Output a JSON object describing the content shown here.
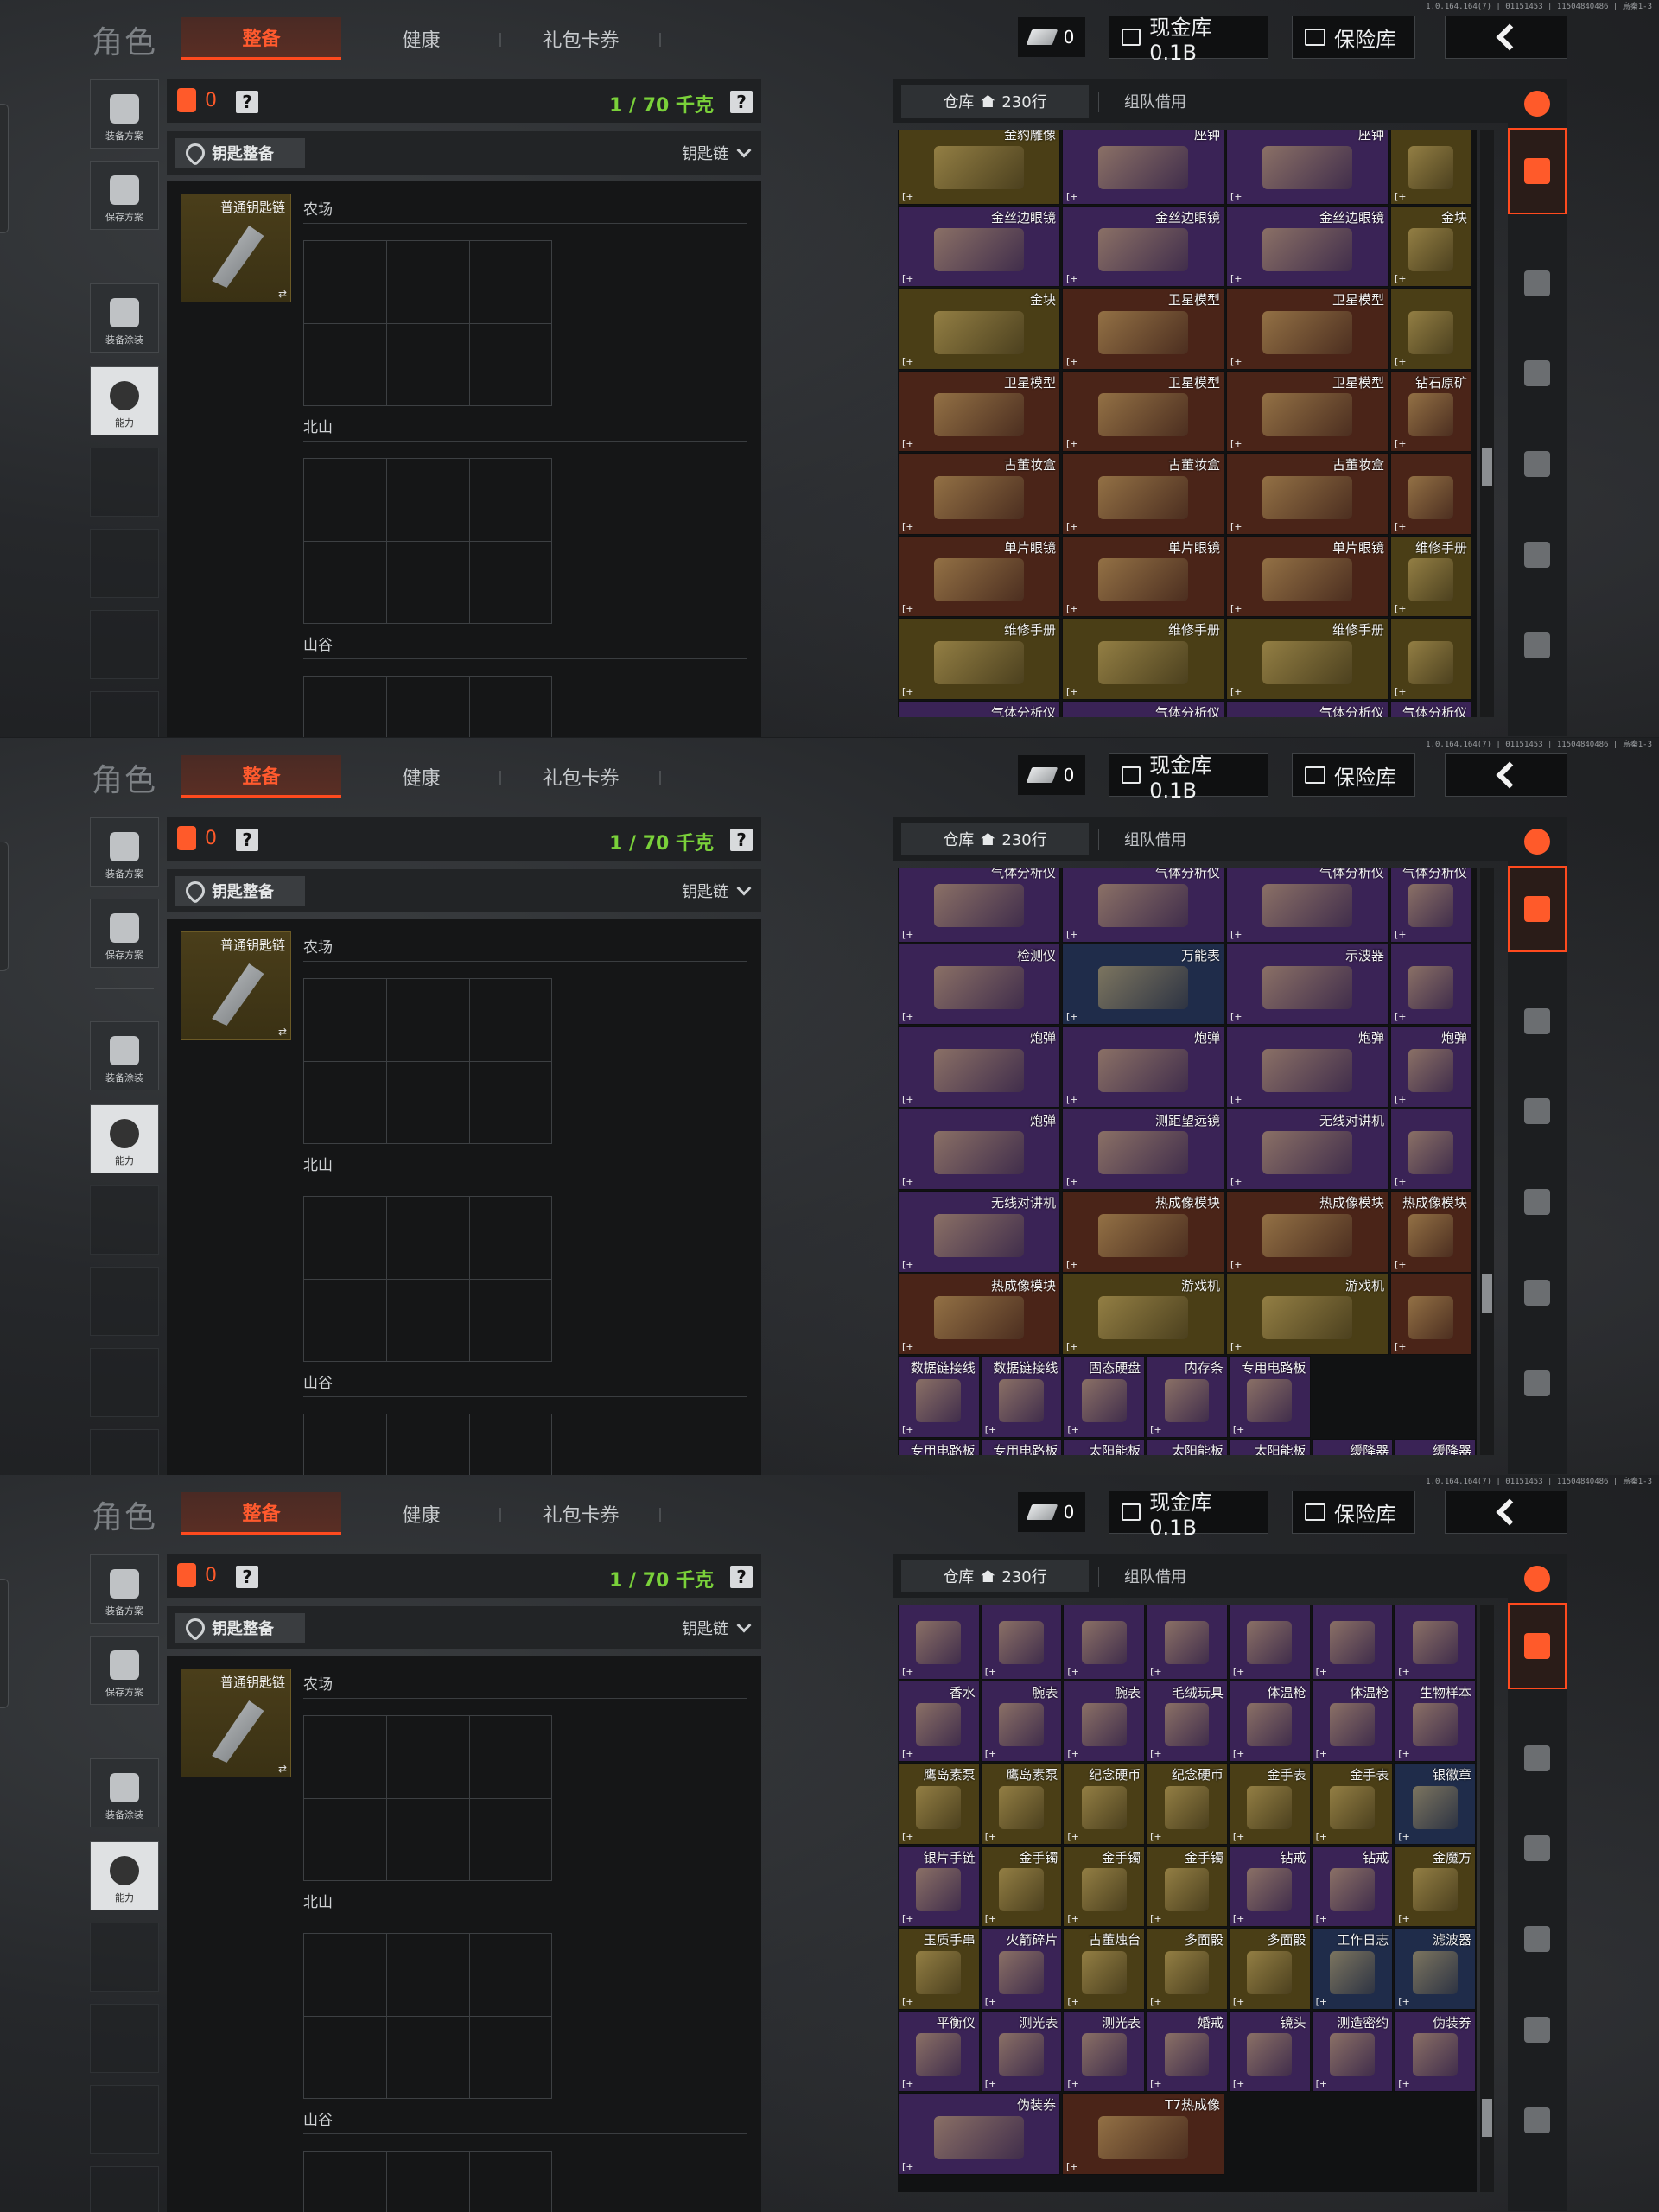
{
  "screens": [
    {
      "version": "1.0.164.164(7) | 01151453 | 11504840486 | 烏秦1-3",
      "title": "角色",
      "tabs": [
        "整备",
        "健康",
        "礼包卡券"
      ],
      "coins": "0",
      "cash_btn": "现金库 0.1B",
      "safe_btn": "保险库",
      "side": [
        "装备方案",
        "保存方案",
        "装备涂装",
        "能力"
      ],
      "bp_count": "0",
      "weight": "1 / 70 千克",
      "key_prep": "钥匙整备",
      "keychain": "钥匙链",
      "key_item": "普通钥匙链",
      "areas": [
        "农场",
        "北山",
        "山谷"
      ],
      "warehouse_tab": "仓库",
      "warehouse_rows": "230行",
      "team_tab": "组队借用",
      "rows": [
        [
          [
            "金豹雕像",
            "#4a3e16"
          ],
          [
            "座钟",
            "#3a2356"
          ],
          [
            "座钟",
            "#3a2356"
          ],
          [
            "",
            "#4a3e16"
          ]
        ],
        [
          [
            "金丝边眼镜",
            "#3a2356"
          ],
          [
            "金丝边眼镜",
            "#3a2356"
          ],
          [
            "金丝边眼镜",
            "#3a2356"
          ],
          [
            "金块",
            "#4a3e16"
          ]
        ],
        [
          [
            "金块",
            "#4a3e16"
          ],
          [
            "卫星模型",
            "#4a2418"
          ],
          [
            "卫星模型",
            "#4a2418"
          ],
          [
            "",
            "#4a3e16"
          ]
        ],
        [
          [
            "卫星模型",
            "#4a2418"
          ],
          [
            "卫星模型",
            "#4a2418"
          ],
          [
            "卫星模型",
            "#4a2418"
          ],
          [
            "钻石原矿",
            "#4a2418"
          ]
        ],
        [
          [
            "古董妆盒",
            "#4a2418"
          ],
          [
            "古董妆盒",
            "#4a2418"
          ],
          [
            "古董妆盒",
            "#4a2418"
          ],
          [
            "",
            "#4a2418"
          ]
        ],
        [
          [
            "单片眼镜",
            "#4a2418"
          ],
          [
            "单片眼镜",
            "#4a2418"
          ],
          [
            "单片眼镜",
            "#4a2418"
          ],
          [
            "维修手册",
            "#4a3e16"
          ]
        ],
        [
          [
            "维修手册",
            "#4a3e16"
          ],
          [
            "维修手册",
            "#4a3e16"
          ],
          [
            "维修手册",
            "#4a3e16"
          ],
          [
            "",
            "#4a3e16"
          ]
        ],
        [
          [
            "气体分析仪",
            "#3a2356"
          ],
          [
            "气体分析仪",
            "#3a2356"
          ],
          [
            "气体分析仪",
            "#3a2356"
          ],
          [
            "气体分析仪",
            "#3a2356"
          ]
        ]
      ],
      "thumb_pct": 58
    },
    {
      "version": "1.0.164.164(7) | 01151453 | 11504840486 | 烏秦1-3",
      "title": "角色",
      "tabs": [
        "整备",
        "健康",
        "礼包卡券"
      ],
      "coins": "0",
      "cash_btn": "现金库 0.1B",
      "safe_btn": "保险库",
      "side": [
        "装备方案",
        "保存方案",
        "装备涂装",
        "能力"
      ],
      "bp_count": "0",
      "weight": "1 / 70 千克",
      "key_prep": "钥匙整备",
      "keychain": "钥匙链",
      "key_item": "普通钥匙链",
      "areas": [
        "农场",
        "北山",
        "山谷"
      ],
      "warehouse_tab": "仓库",
      "warehouse_rows": "230行",
      "team_tab": "组队借用",
      "rows": [
        [
          [
            "气体分析仪",
            "#3a2356"
          ],
          [
            "气体分析仪",
            "#3a2356"
          ],
          [
            "气体分析仪",
            "#3a2356"
          ],
          [
            "气体分析仪",
            "#3a2356"
          ]
        ],
        [
          [
            "检测仪",
            "#3a2356"
          ],
          [
            "万能表",
            "#1f2c4a"
          ],
          [
            "示波器",
            "#3a2356"
          ],
          [
            "",
            "#3a2356"
          ]
        ],
        [
          [
            "炮弹",
            "#3a2356"
          ],
          [
            "炮弹",
            "#3a2356"
          ],
          [
            "炮弹",
            "#3a2356"
          ],
          [
            "炮弹",
            "#3a2356"
          ]
        ],
        [
          [
            "炮弹",
            "#3a2356"
          ],
          [
            "测距望远镜",
            "#3a2356"
          ],
          [
            "无线对讲机",
            "#3a2356"
          ],
          [
            "",
            "#3a2356"
          ]
        ],
        [
          [
            "无线对讲机",
            "#3a2356"
          ],
          [
            "热成像模块",
            "#4a2418"
          ],
          [
            "热成像模块",
            "#4a2418"
          ],
          [
            "热成像模块",
            "#4a2418"
          ]
        ],
        [
          [
            "热成像模块",
            "#4a2418"
          ],
          [
            "游戏机",
            "#4a3e16"
          ],
          [
            "游戏机",
            "#4a3e16"
          ],
          [
            "",
            "#4a2418"
          ]
        ],
        [
          [
            "数据链接线",
            "#3a2356"
          ],
          [
            "数据链接线",
            "#3a2356"
          ],
          [
            "固态硬盘",
            "#3a2356"
          ],
          [
            "内存条",
            "#3a2356"
          ],
          [
            "专用电路板",
            "#3a2356"
          ]
        ],
        [
          [
            "专用电路板",
            "#3a2356"
          ],
          [
            "专用电路板",
            "#3a2356"
          ],
          [
            "太阳能板",
            "#3a2356"
          ],
          [
            "太阳能板",
            "#3a2356"
          ],
          [
            "太阳能板",
            "#3a2356"
          ],
          [
            "缓降器",
            "#3a2356"
          ],
          [
            "缓降器",
            "#3a2356"
          ]
        ]
      ],
      "thumb_pct": 74
    },
    {
      "version": "1.0.164.164(7) | 01151453 | 11504840486 | 烏秦1-3",
      "title": "角色",
      "tabs": [
        "整备",
        "健康",
        "礼包卡券"
      ],
      "coins": "0",
      "cash_btn": "现金库 0.1B",
      "safe_btn": "保险库",
      "side": [
        "装备方案",
        "保存方案",
        "装备涂装",
        "能力"
      ],
      "bp_count": "0",
      "weight": "1 / 70 千克",
      "key_prep": "钥匙整备",
      "keychain": "钥匙链",
      "key_item": "普通钥匙链",
      "areas": [
        "农场",
        "北山",
        "山谷"
      ],
      "warehouse_tab": "仓库",
      "warehouse_rows": "230行",
      "team_tab": "组队借用",
      "rows": [
        [
          [
            "",
            "#3a2356"
          ],
          [
            "",
            "#3a2356"
          ],
          [
            "",
            "#3a2356"
          ],
          [
            "",
            "#3a2356"
          ],
          [
            "",
            "#3a2356"
          ],
          [
            "",
            "#3a2356"
          ],
          [
            "",
            "#3a2356"
          ]
        ],
        [
          [
            "香水",
            "#3a2356"
          ],
          [
            "腕表",
            "#3a2356"
          ],
          [
            "腕表",
            "#3a2356"
          ],
          [
            "毛绒玩具",
            "#3a2356"
          ],
          [
            "体温枪",
            "#3a2356"
          ],
          [
            "体温枪",
            "#3a2356"
          ],
          [
            "生物样本",
            "#3a2356"
          ]
        ],
        [
          [
            "鹰岛素泵",
            "#4a3e16"
          ],
          [
            "鹰岛素泵",
            "#4a3e16"
          ],
          [
            "纪念硬币",
            "#4a3e16"
          ],
          [
            "纪念硬币",
            "#4a3e16"
          ],
          [
            "金手表",
            "#4a3e16"
          ],
          [
            "金手表",
            "#4a3e16"
          ],
          [
            "银徽章",
            "#1f2c4a"
          ]
        ],
        [
          [
            "银片手链",
            "#3a2356"
          ],
          [
            "金手镯",
            "#4a3e16"
          ],
          [
            "金手镯",
            "#4a3e16"
          ],
          [
            "金手镯",
            "#4a3e16"
          ],
          [
            "钻戒",
            "#3a2356"
          ],
          [
            "钻戒",
            "#3a2356"
          ],
          [
            "金魔方",
            "#4a3e16"
          ]
        ],
        [
          [
            "玉质手串",
            "#4a3e16"
          ],
          [
            "火箭碎片",
            "#3a2356"
          ],
          [
            "古董烛台",
            "#4a3e16"
          ],
          [
            "多面骰",
            "#4a3e16"
          ],
          [
            "多面骰",
            "#4a3e16"
          ],
          [
            "工作日志",
            "#1f2c4a"
          ],
          [
            "滤波器",
            "#1f2c4a"
          ]
        ],
        [
          [
            "平衡仪",
            "#3a2356"
          ],
          [
            "测光表",
            "#3a2356"
          ],
          [
            "测光表",
            "#3a2356"
          ],
          [
            "婚戒",
            "#3a2356"
          ],
          [
            "镜头",
            "#3a2356"
          ],
          [
            "测造密约",
            "#3a2356"
          ],
          [
            "伪装券",
            "#3a2356"
          ]
        ],
        [
          [
            "伪装券",
            "#3a2356"
          ],
          [
            "T7热成像",
            "#4a2418"
          ]
        ]
      ],
      "thumb_pct": 90
    }
  ]
}
